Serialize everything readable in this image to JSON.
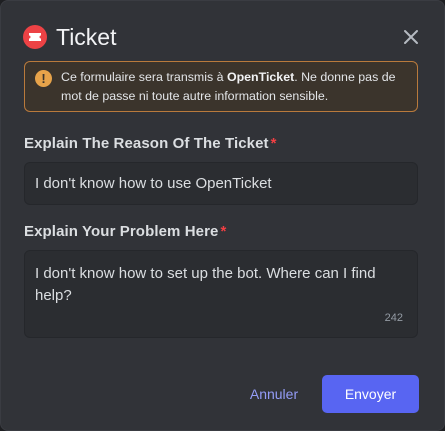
{
  "modal": {
    "title": "Ticket",
    "icon": "ticket-icon",
    "close_icon": "close-icon"
  },
  "warning": {
    "icon": "warning-icon",
    "icon_glyph": "!",
    "text_before": "Ce formulaire sera transmis à ",
    "app_name": "OpenTicket",
    "text_after": ". Ne donne pas de mot de passe ni toute autre information sensible."
  },
  "fields": [
    {
      "label": "Explain The Reason Of The Ticket",
      "required_mark": "*",
      "value": "I don't know how to use OpenTicket"
    },
    {
      "label": "Explain Your Problem Here",
      "required_mark": "*",
      "value": "I don't know how to set up the bot. Where can I find help?",
      "remaining_chars": "242"
    }
  ],
  "actions": {
    "cancel_label": "Annuler",
    "submit_label": "Envoyer"
  },
  "colors": {
    "modal_bg": "#313338",
    "accent": "#5865f2",
    "danger": "#f23f43",
    "warning_border": "#b97a3c",
    "link": "#949cf7"
  }
}
